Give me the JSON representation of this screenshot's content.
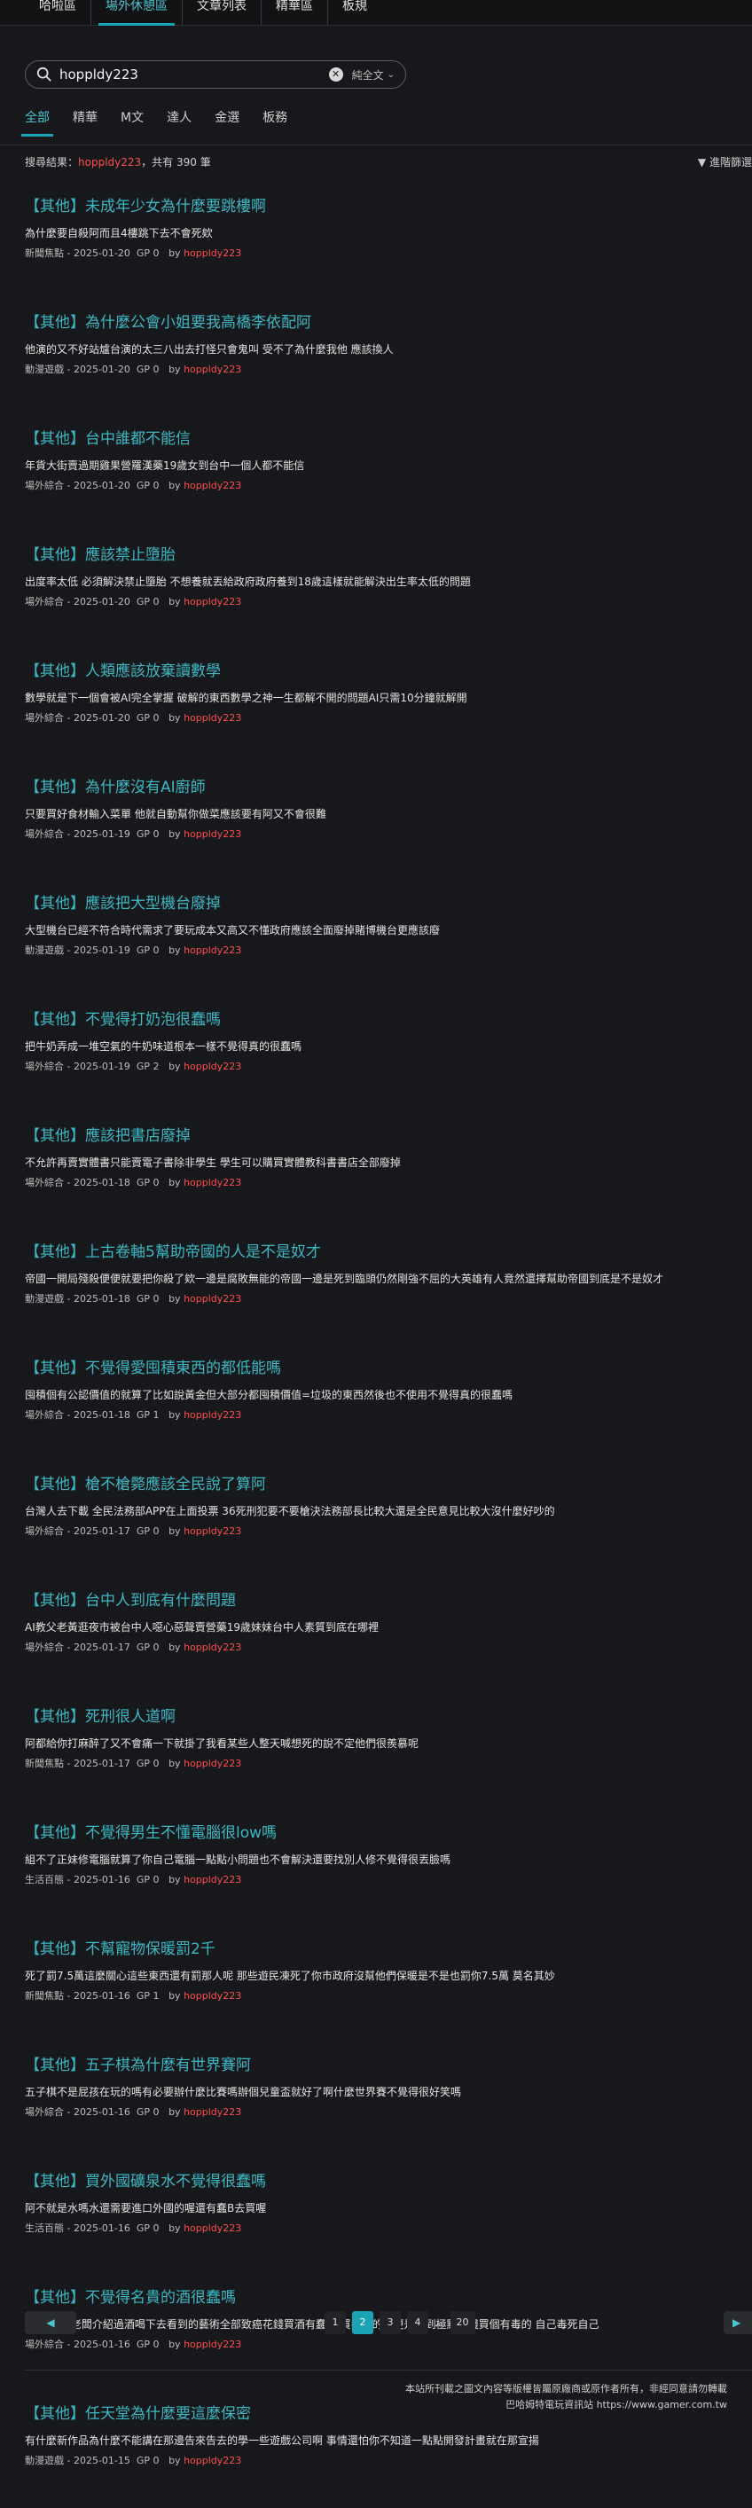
{
  "nav": [
    "哈啦區",
    "場外休憩區",
    "文章列表",
    "精華區",
    "板規"
  ],
  "search": {
    "query": "hoppldy223",
    "scope": "純全文"
  },
  "tabs": [
    "全部",
    "精華",
    "M文",
    "達人",
    "金選",
    "板務"
  ],
  "results": {
    "prefix": "搜尋結果：",
    "keyword": "hoppldy223",
    "count_text": "，共有 390 筆",
    "filter_label": "進階篩選"
  },
  "items": [
    {
      "category": "【其他】",
      "title": "未成年少女為什麼要跳樓啊",
      "excerpt": "為什麼要自殺阿而且4樓跳下去不會死欸",
      "board": "新聞焦點",
      "date": "2025-01-20",
      "gp": "GP 0",
      "by": "by",
      "author": "hoppldy223"
    },
    {
      "category": "【其他】",
      "title": "為什麼公會小姐要我高橋李依配阿",
      "excerpt": "他演的又不好站爐台演的太三八出去打怪只會鬼叫 受不了為什麼我他 應該換人",
      "board": "動漫遊戲",
      "date": "2025-01-20",
      "gp": "GP 0",
      "by": "by",
      "author": "hoppldy223"
    },
    {
      "category": "【其他】",
      "title": "台中誰都不能信",
      "excerpt": "年貨大街賣過期雞果營羅漢藥19歲女到台中一個人都不能信",
      "board": "場外綜合",
      "date": "2025-01-20",
      "gp": "GP 0",
      "by": "by",
      "author": "hoppldy223"
    },
    {
      "category": "【其他】",
      "title": "應該禁止墮胎",
      "excerpt": "出度率太低 必須解決禁止墮胎 不想養就丟給政府政府養到18歲這樣就能解決出生率太低的問題",
      "board": "場外綜合",
      "date": "2025-01-20",
      "gp": "GP 0",
      "by": "by",
      "author": "hoppldy223"
    },
    {
      "category": "【其他】",
      "title": "人類應該放棄讀數學",
      "excerpt": "數學就是下一個會被AI完全掌握 破解的東西數學之神一生都解不開的問題AI只需10分鐘就解開",
      "board": "場外綜合",
      "date": "2025-01-20",
      "gp": "GP 0",
      "by": "by",
      "author": "hoppldy223"
    },
    {
      "category": "【其他】",
      "title": "為什麼沒有AI廚師",
      "excerpt": "只要買好食材輸入菜單 他就自動幫你做菜應該要有阿又不會很難",
      "board": "場外綜合",
      "date": "2025-01-19",
      "gp": "GP 0",
      "by": "by",
      "author": "hoppldy223"
    },
    {
      "category": "【其他】",
      "title": "應該把大型機台廢掉",
      "excerpt": "大型機台已經不符合時代需求了要玩成本又高又不懂政府應該全面廢掉賭博機台更應該廢",
      "board": "動漫遊戲",
      "date": "2025-01-19",
      "gp": "GP 0",
      "by": "by",
      "author": "hoppldy223"
    },
    {
      "category": "【其他】",
      "title": "不覺得打奶泡很蠢嗎",
      "excerpt": "把牛奶弄成一堆空氣的牛奶味道根本一樣不覺得真的很蠢嗎",
      "board": "場外綜合",
      "date": "2025-01-19",
      "gp": "GP 2",
      "by": "by",
      "author": "hoppldy223"
    },
    {
      "category": "【其他】",
      "title": "應該把書店廢掉",
      "excerpt": "不允許再賣實體書只能賣電子書除非學生 學生可以購買實體教科書書店全部廢掉",
      "board": "場外綜合",
      "date": "2025-01-18",
      "gp": "GP 0",
      "by": "by",
      "author": "hoppldy223"
    },
    {
      "category": "【其他】",
      "title": "上古卷軸5幫助帝國的人是不是奴才",
      "excerpt": "帝國一開局殘殺便便就要把你殺了欸一邊是腐敗無能的帝國一邊是死到臨頭仍然剛強不屈的大英雄有人竟然還擇幫助帝國到底是不是奴才",
      "board": "動漫遊戲",
      "date": "2025-01-18",
      "gp": "GP 0",
      "by": "by",
      "author": "hoppldy223"
    },
    {
      "category": "【其他】",
      "title": "不覺得愛囤積東西的都低能嗎",
      "excerpt": "囤積個有公認價值的就算了比如說黃金但大部分都囤積價值=垃圾的東西然後也不使用不覺得真的很蠢嗎",
      "board": "場外綜合",
      "date": "2025-01-18",
      "gp": "GP 1",
      "by": "by",
      "author": "hoppldy223"
    },
    {
      "category": "【其他】",
      "title": "槍不槍斃應該全民說了算阿",
      "excerpt": "台灣人去下載 全民法務部APP在上面投票 36死刑犯要不要槍決法務部長比較大還是全民意見比較大沒什麼好吵的",
      "board": "場外綜合",
      "date": "2025-01-17",
      "gp": "GP 0",
      "by": "by",
      "author": "hoppldy223"
    },
    {
      "category": "【其他】",
      "title": "台中人到底有什麼問題",
      "excerpt": "AI教父老黃逛夜市被台中人噁心惡聲賣營藥19歲妹妹台中人素質到底在哪裡",
      "board": "場外綜合",
      "date": "2025-01-17",
      "gp": "GP 0",
      "by": "by",
      "author": "hoppldy223"
    },
    {
      "category": "【其他】",
      "title": "死刑很人道啊",
      "excerpt": "阿都給你打麻醉了又不會痛一下就掛了我看某些人整天喊想死的說不定他們很羨慕呢",
      "board": "新聞焦點",
      "date": "2025-01-17",
      "gp": "GP 0",
      "by": "by",
      "author": "hoppldy223"
    },
    {
      "category": "【其他】",
      "title": "不覺得男生不懂電腦很low嗎",
      "excerpt": "組不了正妹修電腦就算了你自己電腦一點點小問題也不會解決還要找別人修不覺得很丟臉嗎",
      "board": "生活百態",
      "date": "2025-01-16",
      "gp": "GP 0",
      "by": "by",
      "author": "hoppldy223"
    },
    {
      "category": "【其他】",
      "title": "不幫寵物保暖罰2千",
      "excerpt": "死了罰7.5萬這麼關心這些東西還有罰那人呢 那些遊民凍死了你市政府沒幫他們保暖是不是也罰你7.5萬 莫名其妙",
      "board": "新聞焦點",
      "date": "2025-01-16",
      "gp": "GP 1",
      "by": "by",
      "author": "hoppldy223"
    },
    {
      "category": "【其他】",
      "title": "五子棋為什麼有世界賽阿",
      "excerpt": "五子棋不是屁孩在玩的嗎有必要辦什麼比賽嗎辦個兒童盃就好了啊什麼世界賽不覺得很好笑嗎",
      "board": "場外綜合",
      "date": "2025-01-16",
      "gp": "GP 0",
      "by": "by",
      "author": "hoppldy223"
    },
    {
      "category": "【其他】",
      "title": "買外國礦泉水不覺得很蠢嗎",
      "excerpt": "阿不就是水嗎水還需要進口外國的喔還有蠢B去買喔",
      "board": "生活百態",
      "date": "2025-01-16",
      "gp": "GP 0",
      "by": "by",
      "author": "hoppldy223"
    },
    {
      "category": "【其他】",
      "title": "不覺得名貴的酒很蠢嗎",
      "excerpt": "酒很毒欸 老闆介紹過酒喝下去看到的藝術全部致癌花錢買酒有蠢了 買名貴的酒更是蠢到極點花錢買個有毒的 自己毒死自己",
      "board": "場外綜合",
      "date": "2025-01-16",
      "gp": "GP 0",
      "by": "by",
      "author": "hoppldy223"
    },
    {
      "category": "【其他】",
      "title": "任天堂為什麼要這麼保密",
      "excerpt": "有什麼新作品為什麼不能講在那邊告來告去的學一些遊戲公司啊 事情還怕你不知道一點點開發計畫就在那宣揚",
      "board": "動漫遊戲",
      "date": "2025-01-15",
      "gp": "GP 0",
      "by": "by",
      "author": "hoppldy223"
    }
  ],
  "pagination": {
    "prev": "◀",
    "next": "▶",
    "pages": [
      "1",
      "2",
      "3",
      "4"
    ],
    "ellipsis": "...",
    "last": "20",
    "current": "2"
  },
  "footer": {
    "line1": "本站所刊載之圖文內容等版權皆屬原廠商或原作者所有，非經同意請勿轉載",
    "line2": "巴哈姆特電玩資訊站 https://www.gamer.com.tw"
  }
}
